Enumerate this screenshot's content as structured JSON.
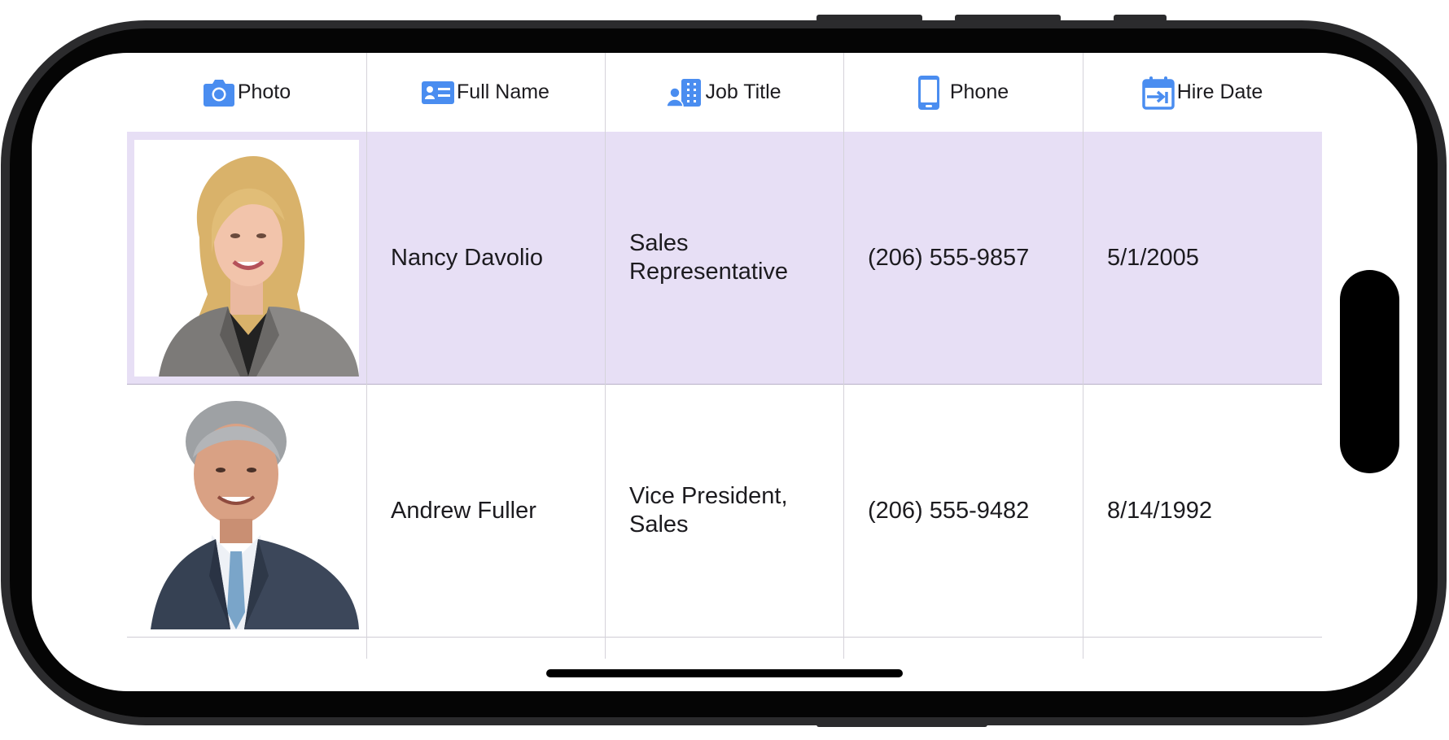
{
  "grid": {
    "columns": [
      {
        "label": "Photo",
        "icon": "camera-icon"
      },
      {
        "label": "Full Name",
        "icon": "id-card-icon"
      },
      {
        "label": "Job Title",
        "icon": "job-title-icon"
      },
      {
        "label": "Phone",
        "icon": "mobile-phone-icon"
      },
      {
        "label": "Hire Date",
        "icon": "calendar-icon"
      }
    ],
    "rows": [
      {
        "photo": "employee-photo-woman",
        "full_name": "Nancy Davolio",
        "job_title": "Sales Representative",
        "phone": "(206) 555-9857",
        "hire_date": "5/1/2005",
        "selected": true
      },
      {
        "photo": "employee-photo-man",
        "full_name": "Andrew Fuller",
        "job_title": "Vice President, Sales",
        "phone": "(206) 555-9482",
        "hire_date": "8/14/1992",
        "selected": false
      }
    ]
  },
  "colors": {
    "accent_icon": "#4a8df0",
    "selected_row_bg": "#e7dff5",
    "grid_line": "#d5d3da",
    "text": "#1c1b1f"
  }
}
